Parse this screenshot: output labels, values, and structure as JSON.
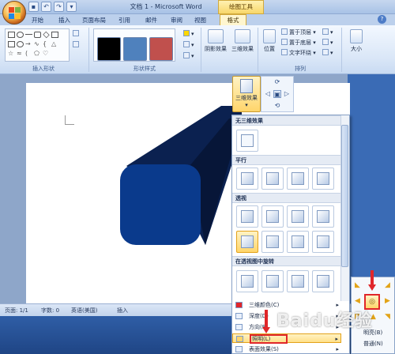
{
  "window": {
    "title": "文档 1 - Microsoft Word",
    "context_tab": "绘图工具"
  },
  "tabs": [
    "开始",
    "插入",
    "页面布局",
    "引用",
    "邮件",
    "审阅",
    "视图",
    "格式"
  ],
  "ribbon": {
    "groups": {
      "insert_shapes": "插入形状",
      "shape_styles": "形状样式",
      "arrange": "排列"
    },
    "buttons": {
      "shadow_effects": "阴影效果",
      "three_d_effects": "三维效果",
      "position": "位置",
      "size": "大小",
      "bring_front": "置于顶层",
      "send_back": "置于底层",
      "text_wrap": "文字环绕"
    },
    "swatch_colors": [
      "#000000",
      "#4f81bd",
      "#c0504d"
    ]
  },
  "dropdown": {
    "button_label": "三维效果",
    "sections": [
      "无三维效果",
      "平行",
      "透视",
      "在透视图中旋转"
    ],
    "menu_items": [
      "三维颜色(C)",
      "深度(D)",
      "方向(R)",
      "照明(L)",
      "表面效果(S)"
    ]
  },
  "lighting_panel": {
    "items": [
      "明亮(B)",
      "普通(N)"
    ]
  },
  "status_bar": {
    "page": "页面: 1/1",
    "words": "字数: 0",
    "language": "英语(美国)",
    "mode": "插入"
  },
  "shape": {
    "front_color": "#0a3a8c",
    "extrusion_color": "#0b2150"
  },
  "watermark": "Baidu经验"
}
